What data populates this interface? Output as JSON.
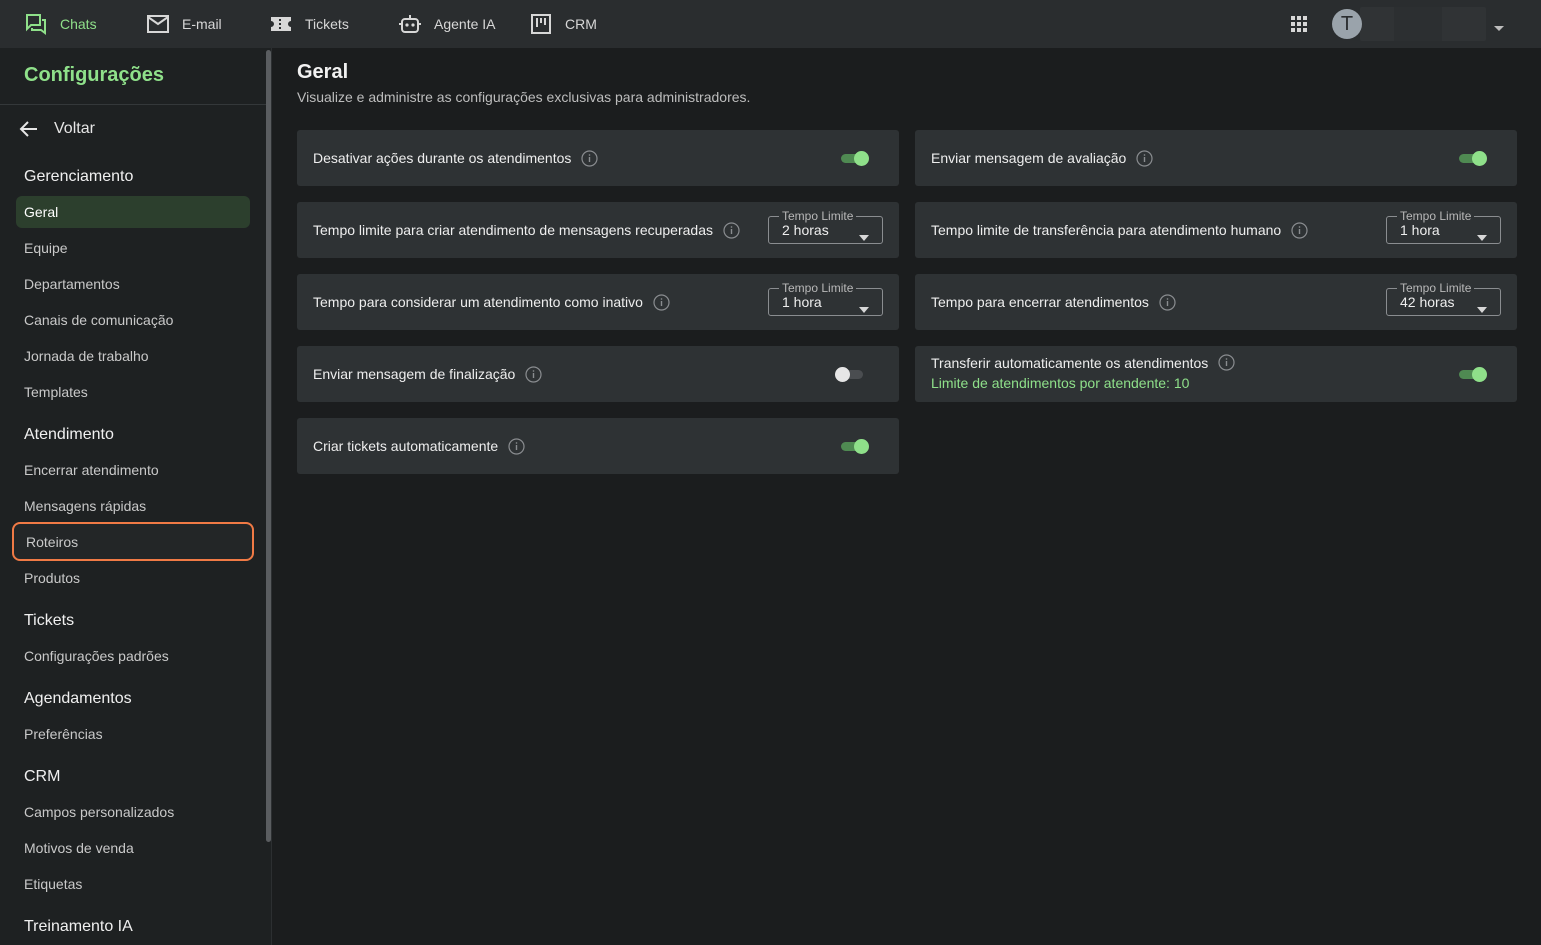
{
  "topnav": {
    "items": [
      {
        "label": "Chats",
        "icon": "chat-icon",
        "active": true
      },
      {
        "label": "E-mail",
        "icon": "mail-icon"
      },
      {
        "label": "Tickets",
        "icon": "ticket-icon"
      },
      {
        "label": "Agente IA",
        "icon": "robot-icon"
      },
      {
        "label": "CRM",
        "icon": "kanban-icon"
      }
    ],
    "avatar_initial": "T"
  },
  "sidebar": {
    "title": "Configurações",
    "back_label": "Voltar",
    "sections": [
      {
        "title": "Gerenciamento",
        "items": [
          "Geral",
          "Equipe",
          "Departamentos",
          "Canais de comunicação",
          "Jornada de trabalho",
          "Templates"
        ]
      },
      {
        "title": "Atendimento",
        "items": [
          "Encerrar atendimento",
          "Mensagens rápidas",
          "Roteiros",
          "Produtos"
        ]
      },
      {
        "title": "Tickets",
        "items": [
          "Configurações padrões"
        ]
      },
      {
        "title": "Agendamentos",
        "items": [
          "Preferências"
        ]
      },
      {
        "title": "CRM",
        "items": [
          "Campos personalizados",
          "Motivos de venda",
          "Etiquetas"
        ]
      },
      {
        "title": "Treinamento IA",
        "items": []
      }
    ],
    "active_item": "Geral",
    "highlighted_item": "Roteiros"
  },
  "page": {
    "title": "Geral",
    "subtitle": "Visualize e administre as configurações exclusivas para administradores."
  },
  "settings": {
    "left": [
      {
        "label": "Desativar ações durante os atendimentos",
        "control": "toggle",
        "on": true
      },
      {
        "label": "Tempo limite para criar atendimento de mensagens recuperadas",
        "control": "select",
        "select_label": "Tempo Limite",
        "value": "2 horas"
      },
      {
        "label": "Tempo para considerar um atendimento como inativo",
        "control": "select",
        "select_label": "Tempo Limite",
        "value": "1 hora"
      },
      {
        "label": "Enviar mensagem de finalização",
        "control": "toggle",
        "on": false
      },
      {
        "label": "Criar tickets automaticamente",
        "control": "toggle",
        "on": true
      }
    ],
    "right": [
      {
        "label": "Enviar mensagem de avaliação",
        "control": "toggle",
        "on": true
      },
      {
        "label": "Tempo limite de transferência para atendimento humano",
        "control": "select",
        "select_label": "Tempo Limite",
        "value": "1 hora"
      },
      {
        "label": "Tempo para encerrar atendimentos",
        "control": "select",
        "select_label": "Tempo Limite",
        "value": "42 horas"
      },
      {
        "label": "Transferir automaticamente os atendimentos",
        "sublabel": "Limite de atendimentos por atendente: 10",
        "control": "toggle",
        "on": true
      }
    ]
  },
  "colors": {
    "accent": "#8fe08a",
    "highlight_border": "#f07a45",
    "card_bg": "#2e3234"
  }
}
